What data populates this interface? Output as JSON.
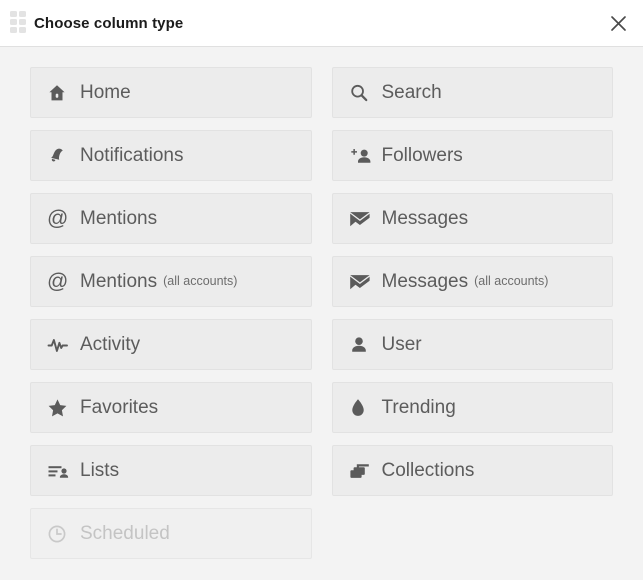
{
  "dialog": {
    "title": "Choose column type",
    "drag_handle_icon": "drag-dots-icon",
    "close_icon": "close-icon"
  },
  "columns": [
    {
      "label": "Home",
      "sub": "",
      "icon": "home-icon",
      "disabled": false
    },
    {
      "label": "Search",
      "sub": "",
      "icon": "search-icon",
      "disabled": false
    },
    {
      "label": "Notifications",
      "sub": "",
      "icon": "bell-icon",
      "disabled": false
    },
    {
      "label": "Followers",
      "sub": "",
      "icon": "user-plus-icon",
      "disabled": false
    },
    {
      "label": "Mentions",
      "sub": "",
      "icon": "at-icon",
      "disabled": false
    },
    {
      "label": "Messages",
      "sub": "",
      "icon": "envelope-icon",
      "disabled": false
    },
    {
      "label": "Mentions",
      "sub": "(all accounts)",
      "icon": "at-icon",
      "disabled": false
    },
    {
      "label": "Messages",
      "sub": "(all accounts)",
      "icon": "envelope-icon",
      "disabled": false
    },
    {
      "label": "Activity",
      "sub": "",
      "icon": "pulse-icon",
      "disabled": false
    },
    {
      "label": "User",
      "sub": "",
      "icon": "user-icon",
      "disabled": false
    },
    {
      "label": "Favorites",
      "sub": "",
      "icon": "star-icon",
      "disabled": false
    },
    {
      "label": "Trending",
      "sub": "",
      "icon": "flame-icon",
      "disabled": false
    },
    {
      "label": "Lists",
      "sub": "",
      "icon": "list-user-icon",
      "disabled": false
    },
    {
      "label": "Collections",
      "sub": "",
      "icon": "stacked-cards-icon",
      "disabled": false
    },
    {
      "label": "Scheduled",
      "sub": "",
      "icon": "clock-icon",
      "disabled": true
    }
  ],
  "colors": {
    "panel_background": "#f3f3f3",
    "titlebar_background": "#ffffff",
    "button_background": "#ececec",
    "button_border": "#e2e2e2",
    "label_text": "#5c5c5c",
    "title_text": "#1c1c1c",
    "disabled_text": "#c4c4c4"
  }
}
